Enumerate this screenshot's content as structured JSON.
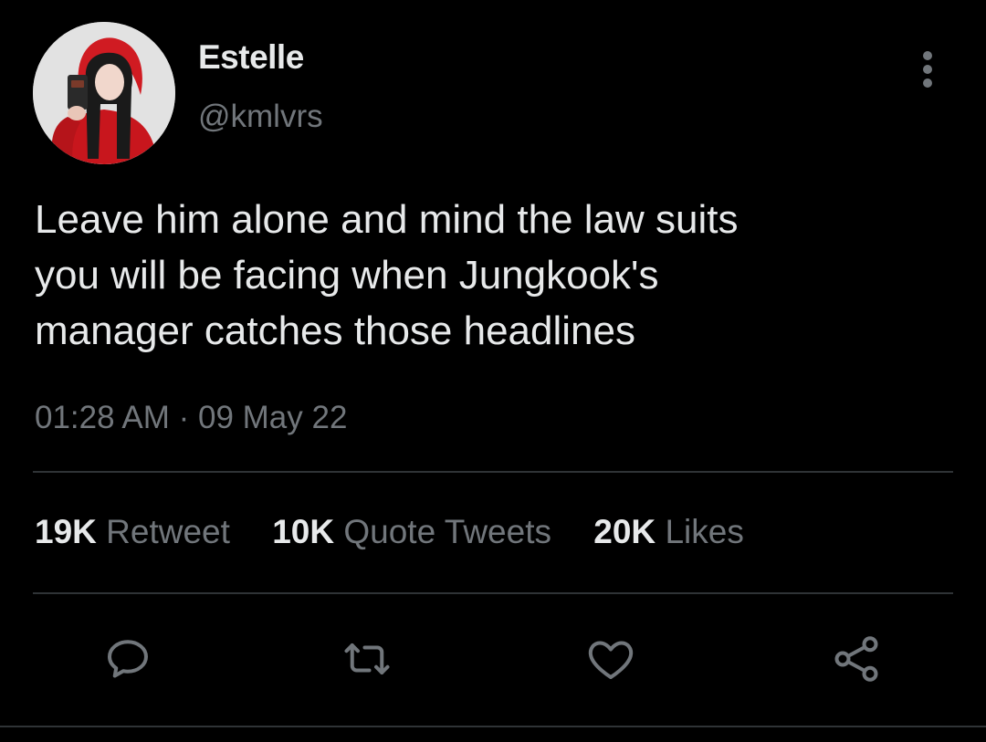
{
  "tweet": {
    "author": {
      "name": "Estelle",
      "handle": "@kmlvrs"
    },
    "text": "Leave him alone and mind the law suits\nyou will be facing when Jungkook's\nmanager catches those headlines",
    "timestamp": "01:28 AM · 09 May 22",
    "stats": [
      {
        "count": "19K",
        "label": "Retweet"
      },
      {
        "count": "10K",
        "label": "Quote Tweets"
      },
      {
        "count": "20K",
        "label": "Likes"
      }
    ],
    "actions": [
      "reply-icon",
      "retweet-icon",
      "like-icon",
      "share-icon"
    ]
  },
  "colors": {
    "background": "#000000",
    "primary_text": "#e7e9ea",
    "secondary_text": "#71767b",
    "divider": "#2f3336"
  }
}
